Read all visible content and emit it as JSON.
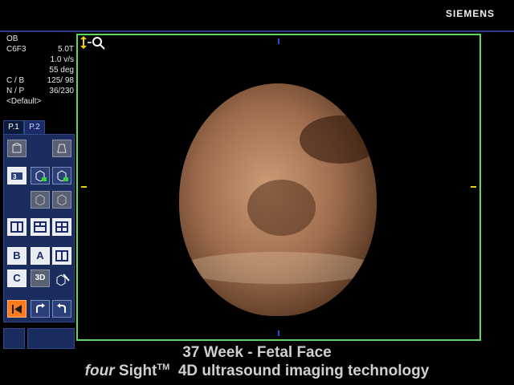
{
  "header": {
    "brand": "SIEMENS"
  },
  "params": {
    "mode": "OB",
    "transducer": "C6F3",
    "freq": "5.0T",
    "volume_rate": "1.0 v/s",
    "angle": "55 deg",
    "cb_label": "C / B",
    "cb_value": "125/ 98",
    "np_label": "N / P",
    "np_value": "36/230",
    "preset": "<Default>"
  },
  "tabs": [
    {
      "label": "P.1"
    },
    {
      "label": "P.2"
    }
  ],
  "buttons": {
    "b": "B",
    "a": "A",
    "c": "C",
    "three_d": "3D"
  },
  "caption": {
    "line1": "37 Week  -  Fetal Face",
    "four": "four",
    "sight": "Sight",
    "tm": "TM",
    "line2_rest": "4D ultrasound imaging technology"
  },
  "colors": {
    "viewport_border": "#5cd85c",
    "panel_bg": "#1b2d5e",
    "accent_orange": "#ff7a1a"
  }
}
